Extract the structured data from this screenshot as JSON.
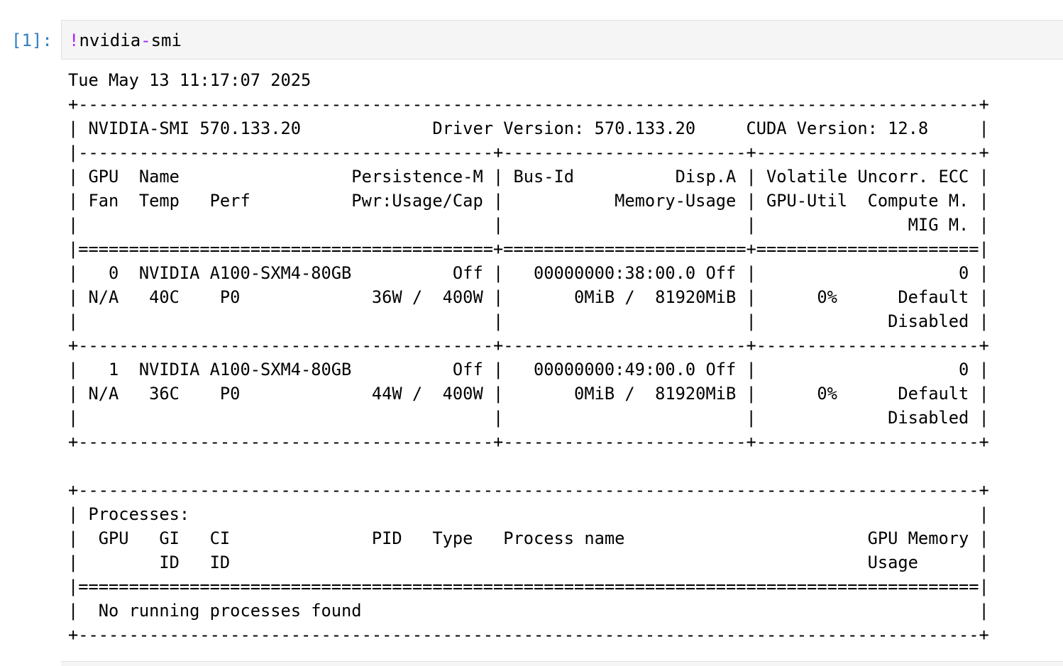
{
  "cell": {
    "prompt": "[1]:",
    "code_bang": "!",
    "code_part1": "nvidia",
    "code_op": "-",
    "code_part2": "smi"
  },
  "output": {
    "lines": [
      "Tue May 13 11:17:07 2025",
      "+-----------------------------------------------------------------------------------------+",
      "| NVIDIA-SMI 570.133.20             Driver Version: 570.133.20     CUDA Version: 12.8     |",
      "|-----------------------------------------+------------------------+----------------------+",
      "| GPU  Name                 Persistence-M | Bus-Id          Disp.A | Volatile Uncorr. ECC |",
      "| Fan  Temp   Perf          Pwr:Usage/Cap |           Memory-Usage | GPU-Util  Compute M. |",
      "|                                         |                        |               MIG M. |",
      "|=========================================+========================+======================|",
      "|   0  NVIDIA A100-SXM4-80GB          Off |   00000000:38:00.0 Off |                    0 |",
      "| N/A   40C    P0             36W /  400W |       0MiB /  81920MiB |      0%      Default |",
      "|                                         |                        |             Disabled |",
      "+-----------------------------------------+------------------------+----------------------+",
      "|   1  NVIDIA A100-SXM4-80GB          Off |   00000000:49:00.0 Off |                    0 |",
      "| N/A   36C    P0             44W /  400W |       0MiB /  81920MiB |      0%      Default |",
      "|                                         |                        |             Disabled |",
      "+-----------------------------------------+------------------------+----------------------+",
      "",
      "+-----------------------------------------------------------------------------------------+",
      "| Processes:                                                                              |",
      "|  GPU   GI   CI              PID   Type   Process name                        GPU Memory |",
      "|        ID   ID                                                               Usage      |",
      "|=========================================================================================|",
      "|  No running processes found                                                             |",
      "+-----------------------------------------------------------------------------------------+"
    ]
  }
}
